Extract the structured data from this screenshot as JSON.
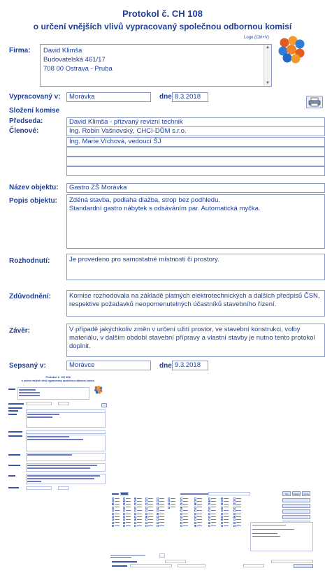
{
  "header": {
    "title_line1": "Protokol č.  CH 108",
    "title_line2": "o určení vnějších vlivů vypracovaný společnou odbornou komisí"
  },
  "logo": {
    "button_label": "Logo (Ctrl+V)",
    "icon": "molecule-logo-icon"
  },
  "firm": {
    "label": "Firma:",
    "name": "David Klimša",
    "street": "Budovatelská 461/17",
    "city": "708 00 Ostrava - Pruba"
  },
  "prepared": {
    "label": "Vypracovaný v:",
    "place": "Morávka",
    "date_label": "dne",
    "date": "8.3.2018"
  },
  "print": {
    "icon": "printer-icon"
  },
  "committee": {
    "heading": "Složení komise",
    "chair_label": "Předseda:",
    "chair": "David Klimša - přizvaný revizní technik",
    "members_label": "Členové:",
    "members": [
      "Ing. Robin Vašnovský, CHCI-DŮM s.r.o.",
      "Ing. Marie Víchová, vedoucí ŠJ",
      "",
      "",
      ""
    ]
  },
  "object": {
    "name_label": "Název objektu:",
    "name": "Gastro ZŠ Morávka",
    "desc_label": "Popis objektu:",
    "desc": "Zděná stavba, podlaha dlažba, strop bez podhledu.\nStandardní gastro nábytek s odsáváním par. Automatická myčka."
  },
  "decision": {
    "label": "Rozhodnutí:",
    "text": "Je provedeno pro samostatné místnosti či prostory."
  },
  "reasoning": {
    "label": "Zdůvodnění:",
    "text": "Komise rozhodovala na základě platných elektrotechnických a dalších předpisů ČSN, respektive požadavků neopomenutelných účastníků stavebního řízení."
  },
  "conclusion": {
    "label": "Závěr:",
    "text": "V případě jakýchkoliv změn v určení užití prostor, ve stavební konstrukci, volby materiálu, v dalším období stavební přípravy a vlastní stavby je nutno tento protokol doplnit."
  },
  "signed": {
    "label": "Sepsaný v:",
    "place": "Morávce",
    "date_label": "dne",
    "date": "9.3.2018"
  },
  "thumbnail": {
    "title_line1": "Protokol č.  CH 108",
    "title_line2": "o určení vnějších vlivů vypracovaný společnou odbornou komisí",
    "side_buttons": [
      "Tisk",
      "Náhled",
      "Uložit",
      "",
      "",
      "",
      ""
    ],
    "accent": "#3a56a8"
  }
}
